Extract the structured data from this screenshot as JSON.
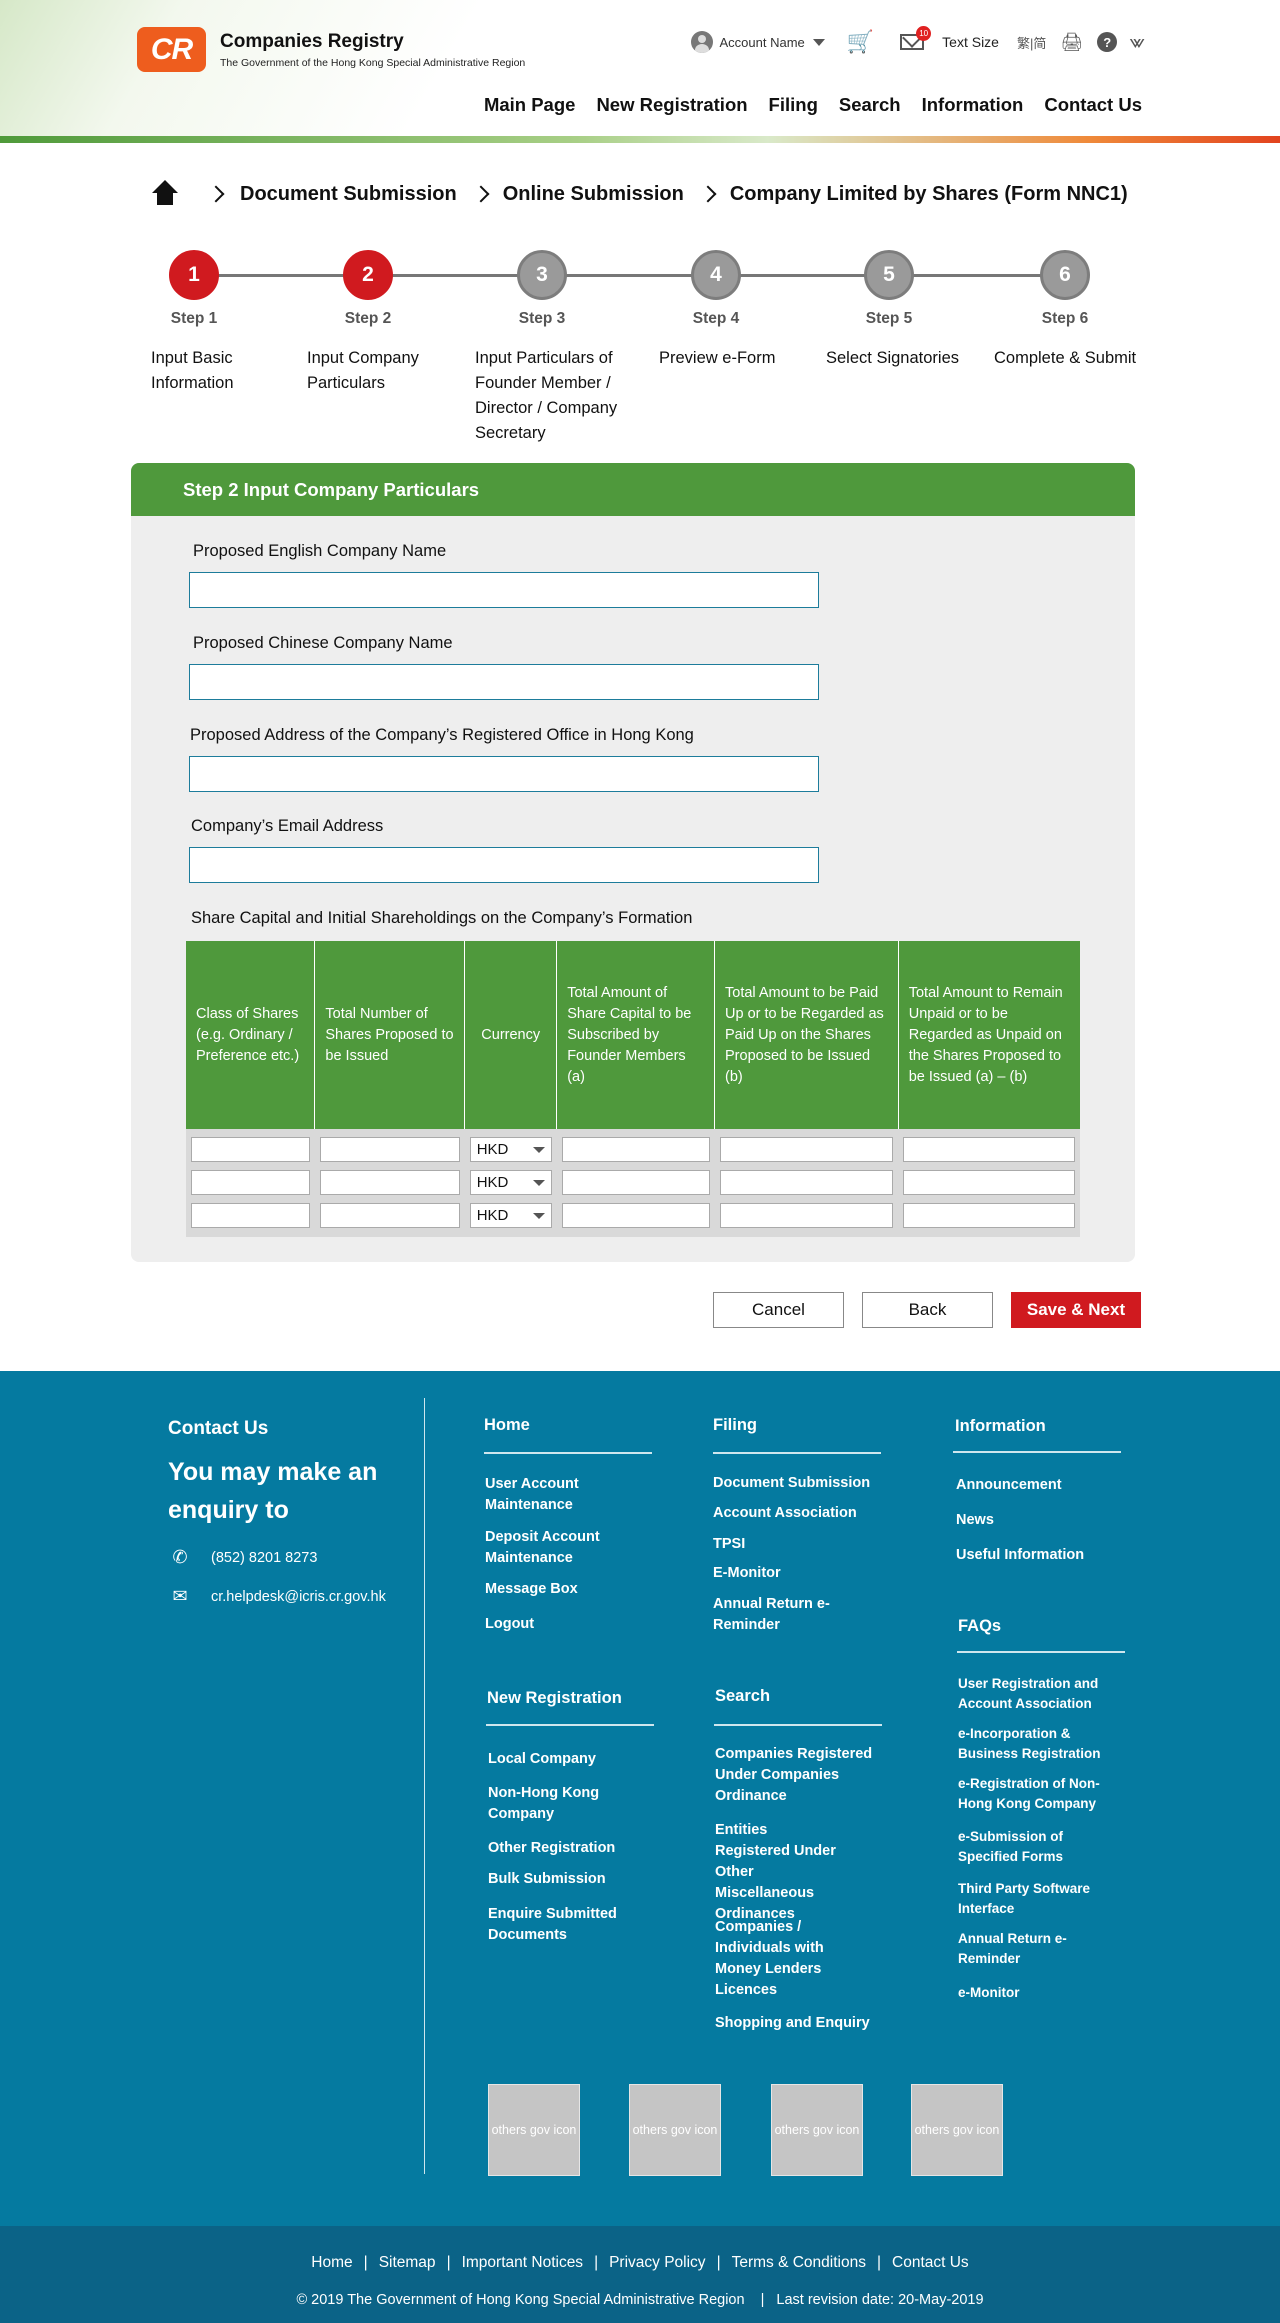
{
  "header": {
    "logo_mark": "CR",
    "logo_title": "Companies Registry",
    "logo_subtitle": "The Government of the Hong Kong Special Administrative Region",
    "account_name": "Account Name",
    "mail_badge": "10",
    "text_size": "Text Size",
    "lang_toggle": "繁|简",
    "icons": [
      "user-icon",
      "cart-icon",
      "mail-icon",
      "print-icon",
      "help-icon",
      "share-icon"
    ],
    "nav": [
      "Main Page",
      "New Registration",
      "Filing",
      "Search",
      "Information",
      "Contact Us"
    ]
  },
  "breadcrumb": {
    "items": [
      "Document Submission",
      "Online Submission",
      "Company Limited by Shares (Form NNC1)"
    ]
  },
  "stepper": {
    "steps": [
      {
        "number": "1",
        "label": "Step 1",
        "desc": "Input Basic Information",
        "state": "active"
      },
      {
        "number": "2",
        "label": "Step 2",
        "desc": "Input Company Particulars",
        "state": "active"
      },
      {
        "number": "3",
        "label": "Step 3",
        "desc": "Input Particulars of Founder Member / Director / Company Secretary",
        "state": "inactive"
      },
      {
        "number": "4",
        "label": "Step 4",
        "desc": "Preview e-Form",
        "state": "inactive"
      },
      {
        "number": "5",
        "label": "Step 5",
        "desc": "Select Signatories",
        "state": "inactive"
      },
      {
        "number": "6",
        "label": "Step 6",
        "desc": "Complete & Submit",
        "state": "inactive"
      }
    ]
  },
  "form": {
    "title": "Step 2 Input Company Particulars",
    "fields": [
      {
        "label": "Proposed English Company Name",
        "value": ""
      },
      {
        "label": "Proposed Chinese Company Name",
        "value": ""
      },
      {
        "label": "Proposed Address of the Company’s Registered Office in Hong Kong",
        "value": ""
      },
      {
        "label": "Company’s Email Address",
        "value": ""
      }
    ],
    "share_title": "Share Capital and Initial Shareholdings on the Company’s Formation",
    "table_headers": [
      "Class of Shares (e.g. Ordinary / Preference etc.)",
      "Total Number of Shares Proposed to be Issued",
      "Currency",
      "Total Amount of Share Capital to be Subscribed by Founder Members (a)",
      "Total Amount to be Paid Up or to be Regarded as Paid Up on the Shares Proposed to be Issued (b)",
      "Total Amount to Remain Unpaid or to be Regarded as Unpaid on the Shares Proposed to be Issued (a) – (b)"
    ],
    "rows": [
      {
        "currency": "HKD"
      },
      {
        "currency": "HKD"
      },
      {
        "currency": "HKD"
      }
    ]
  },
  "actions": {
    "cancel": "Cancel",
    "back": "Back",
    "save_next": "Save & Next"
  },
  "footer": {
    "contact_title": "Contact Us",
    "enquiry": "You may make an enquiry to",
    "phone": "(852) 8201 8273",
    "email": "cr.helpdesk@icris.cr.gov.hk",
    "home": {
      "title": "Home",
      "links": [
        "User Account Maintenance",
        "Deposit Account Maintenance",
        "Message Box",
        "Logout"
      ]
    },
    "filing": {
      "title": "Filing",
      "links": [
        "Document Submission",
        "Account Association",
        "TPSI",
        "E-Monitor",
        "Annual Return e-Reminder"
      ]
    },
    "information": {
      "title": "Information",
      "links": [
        "Announcement",
        "News",
        "Useful Information"
      ]
    },
    "faqs": {
      "title": "FAQs",
      "links": [
        "User Registration and Account Association",
        "e-Incorporation & Business Registration",
        "e-Registration of Non-Hong Kong Company",
        "e-Submission of Specified Forms",
        "Third Party Software Interface",
        "Annual Return e-Reminder",
        "e-Monitor"
      ]
    },
    "new_registration": {
      "title": "New Registration",
      "links": [
        "Local Company",
        "Non-Hong Kong Company",
        "Other Registration",
        "Bulk Submission",
        "Enquire Submitted Documents"
      ]
    },
    "search": {
      "title": "Search",
      "links": [
        "Companies Registered Under Companies Ordinance",
        "Entities Registered Under Other Miscellaneous Ordinances",
        "Companies / Individuals with Money Lenders Licences",
        "Shopping and Enquiry"
      ]
    },
    "gov_icons": [
      "others gov icon",
      "others gov icon",
      "others gov icon",
      "others gov icon"
    ]
  },
  "subfooter": {
    "links": [
      "Home",
      "Sitemap",
      "Important Notices",
      "Privacy Policy",
      "Terms & Conditions",
      "Contact Us"
    ],
    "copyright": "© 2019 The Government of Hong Kong Special Administrative Region",
    "revision": "Last revision date: 20-May-2019"
  }
}
